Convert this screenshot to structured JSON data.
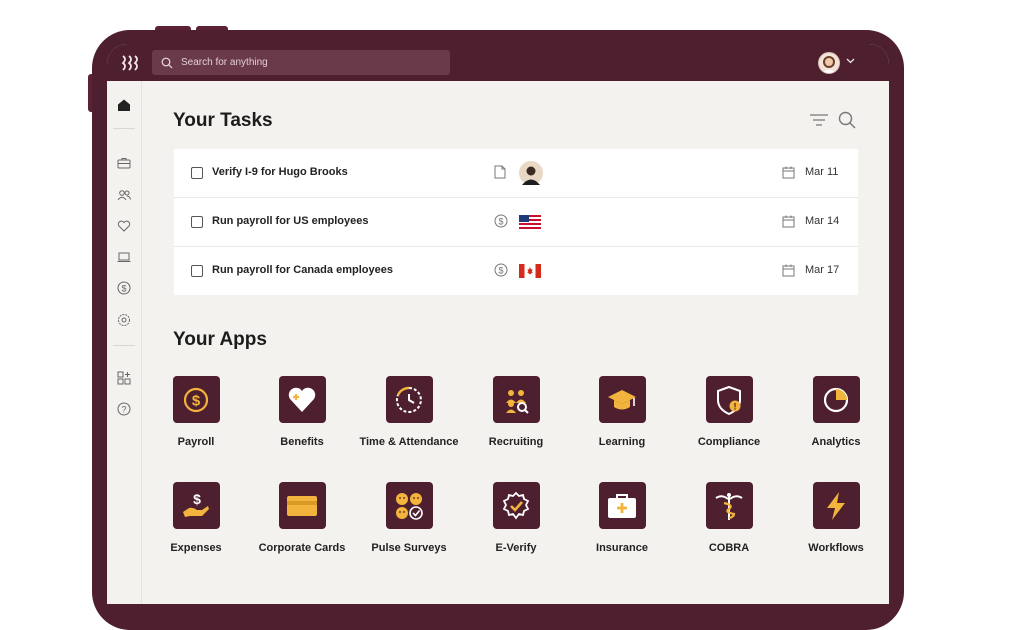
{
  "search": {
    "placeholder": "Search for anything"
  },
  "tasks_section": {
    "title": "Your Tasks"
  },
  "tasks": [
    {
      "label": "Verify I-9 for Hugo Brooks",
      "type_icon": "document-icon",
      "tag": "avatar",
      "date": "Mar 11"
    },
    {
      "label": "Run payroll for US employees",
      "type_icon": "dollar-icon",
      "tag": "us-flag",
      "date": "Mar 14"
    },
    {
      "label": "Run payroll for Canada employees",
      "type_icon": "dollar-icon",
      "tag": "canada-flag",
      "date": "Mar 17"
    }
  ],
  "apps_section": {
    "title": "Your Apps"
  },
  "apps": [
    {
      "label": "Payroll",
      "icon": "payroll-icon"
    },
    {
      "label": "Benefits",
      "icon": "benefits-icon"
    },
    {
      "label": "Time & Attendance",
      "icon": "time-attendance-icon"
    },
    {
      "label": "Recruiting",
      "icon": "recruiting-icon"
    },
    {
      "label": "Learning",
      "icon": "learning-icon"
    },
    {
      "label": "Compliance",
      "icon": "compliance-icon"
    },
    {
      "label": "Analytics",
      "icon": "analytics-icon"
    },
    {
      "label": "Expenses",
      "icon": "expenses-icon"
    },
    {
      "label": "Corporate Cards",
      "icon": "corporate-cards-icon"
    },
    {
      "label": "Pulse Surveys",
      "icon": "pulse-surveys-icon"
    },
    {
      "label": "E-Verify",
      "icon": "e-verify-icon"
    },
    {
      "label": "Insurance",
      "icon": "insurance-icon"
    },
    {
      "label": "COBRA",
      "icon": "cobra-icon"
    },
    {
      "label": "Workflows",
      "icon": "workflows-icon"
    }
  ],
  "colors": {
    "brand": "#4d1f2f",
    "accent": "#f2b43c",
    "background": "#f4f2ef"
  }
}
